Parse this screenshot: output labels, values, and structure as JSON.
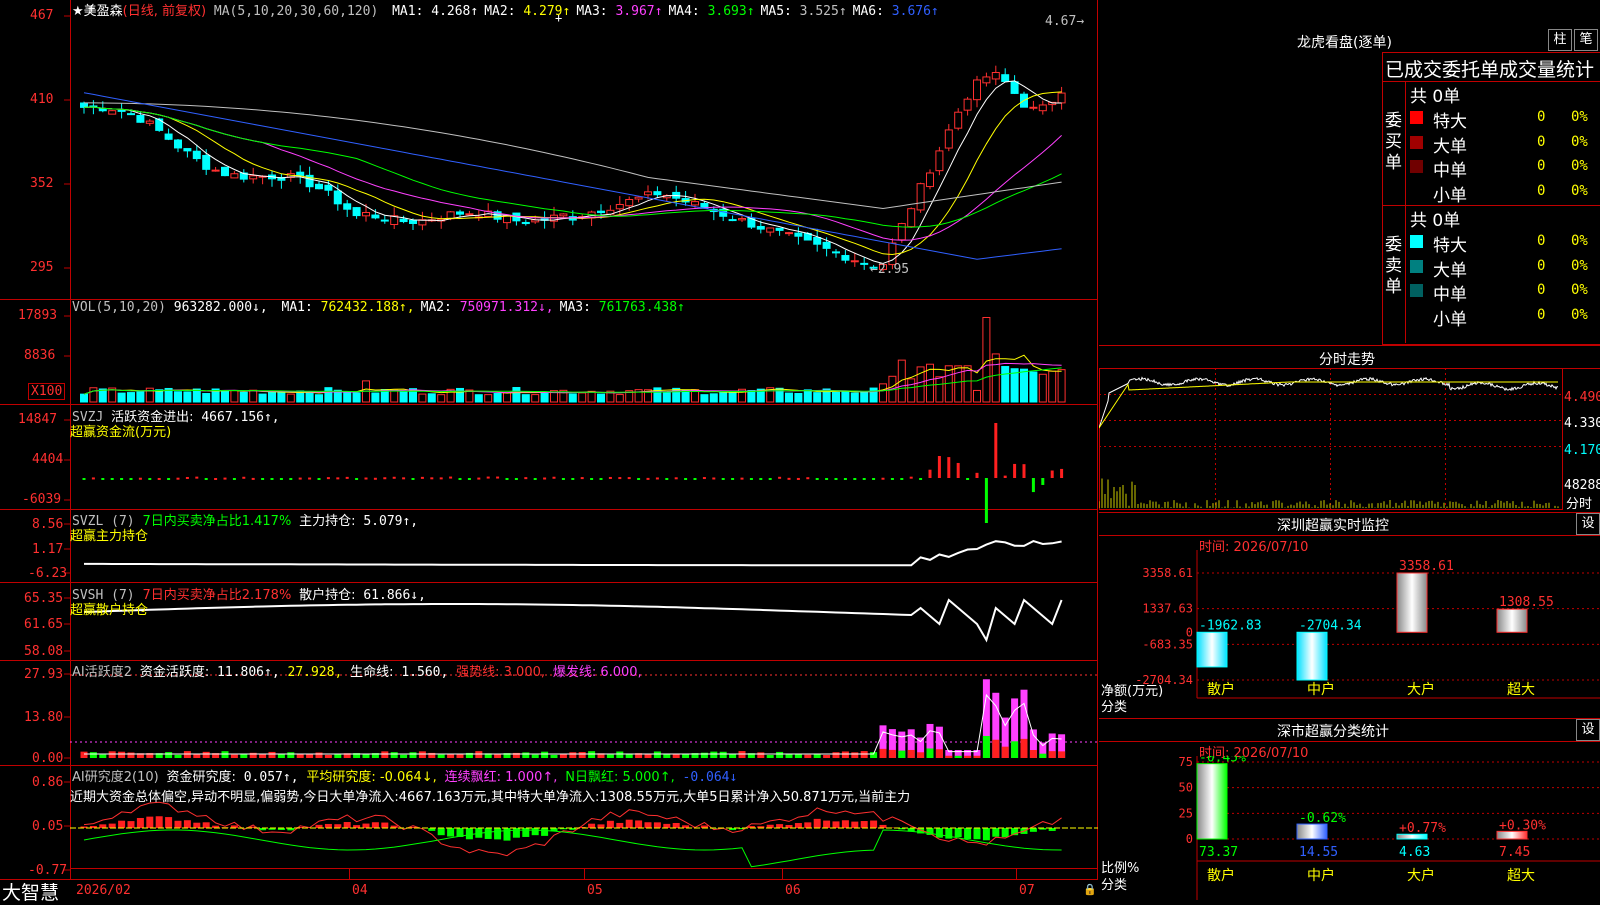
{
  "app": {
    "logo": "大智慧"
  },
  "main_chart": {
    "stock": "★美盈森",
    "period": "(日线, 前复权)",
    "ma_label": "MA(5,10,20,30,60,120)",
    "ma": [
      {
        "name": "MA1:",
        "value": "4.268↑",
        "color": "#ffffff"
      },
      {
        "name": "MA2:",
        "value": "4.279↑",
        "color": "#ffff00"
      },
      {
        "name": "MA3:",
        "value": "3.967↑",
        "color": "#ff40ff"
      },
      {
        "name": "MA4:",
        "value": "3.693↑",
        "color": "#00ff00"
      },
      {
        "name": "MA5:",
        "value": "3.525↑",
        "color": "#c0c0c0"
      },
      {
        "name": "MA6:",
        "value": "3.676↑",
        "color": "#3060ff"
      }
    ],
    "y_ticks": [
      "467",
      "410",
      "352",
      "295"
    ],
    "high_label": "4.67",
    "low_label": "2.95"
  },
  "volume": {
    "label": "VOL(5,10,20)",
    "vol_value": "963282.000↓,",
    "ma": [
      {
        "name": "MA1:",
        "value": "762432.188↑,",
        "color": "#ffff00"
      },
      {
        "name": "MA2:",
        "value": "750971.312↓,",
        "color": "#ff40ff"
      },
      {
        "name": "MA3:",
        "value": "761763.438↑",
        "color": "#00ff00"
      }
    ],
    "y_ticks": [
      "17893",
      "8836"
    ],
    "unit": "X100"
  },
  "svzj": {
    "label": "SVZJ",
    "desc": "活跃资金进出:",
    "value": "4667.156↑,",
    "subtitle": "超赢资金流(万元)",
    "y_ticks": [
      "14847",
      "4404",
      "-6039"
    ]
  },
  "svzl": {
    "label": "SVZL (7)",
    "desc1": "7日内买卖净占比1.417%",
    "desc2": "主力持仓:",
    "value": "5.079↑,",
    "subtitle": "超赢主力持仓",
    "y_ticks": [
      "8.56",
      "1.17",
      "-6.23"
    ]
  },
  "svsh": {
    "label": "SVSH (7)",
    "desc1": "7日内买卖净占比2.178%",
    "desc2": "散户持仓:",
    "value": "61.866↓,",
    "subtitle": "超赢散户持仓",
    "y_ticks": [
      "65.35",
      "61.65",
      "58.08"
    ]
  },
  "ai_active": {
    "label": "AI活跃度2",
    "desc": "资金活跃度:",
    "v1": "11.806↑,",
    "v2": "27.928,",
    "life_label": "生命线:",
    "life": "1.560,",
    "strong": "强势线: 3.000,",
    "burst": "爆发线: 6.000,",
    "y_ticks": [
      "27.93",
      "13.80",
      "0.00"
    ]
  },
  "ai_research": {
    "label": "AI研究度2(10)",
    "desc": "资金研究度:",
    "v1": "0.057↑,",
    "avg": "平均研究度: -0.064↓,",
    "cont": "连续飘红: 1.000↑,",
    "nday": "N日飘红: 5.000↑,",
    "v5": "-0.064↓",
    "summary": "近期大资金总体偏空,异动不明显,偏弱势,今日大单净流入:4667.163万元,其中特大单净流入:1308.55万元,大单5日累计净入50.871万元,当前主力",
    "y_ticks": [
      "0.86",
      "0.05",
      "-0.77"
    ]
  },
  "x_axis": [
    "2026/02",
    "04",
    "05",
    "06",
    "07"
  ],
  "right_panel": {
    "longhu": {
      "title": "龙虎看盘(逐单)",
      "btn1": "柱",
      "btn2": "笔",
      "header": "已成交委托单成交量统计",
      "buy_label": "委买单",
      "sell_label": "委卖单",
      "buy_total": "共 0单",
      "sell_total": "共 0单",
      "buy_rows": [
        {
          "name": "特大",
          "count": "0",
          "pct": "0%",
          "color": "#ff0000"
        },
        {
          "name": "大单",
          "count": "0",
          "pct": "0%",
          "color": "#a00000"
        },
        {
          "name": "中单",
          "count": "0",
          "pct": "0%",
          "color": "#700000"
        },
        {
          "name": "小单",
          "count": "0",
          "pct": "0%",
          "color": ""
        }
      ],
      "sell_rows": [
        {
          "name": "特大",
          "count": "0",
          "pct": "0%",
          "color": "#00ffff"
        },
        {
          "name": "大单",
          "count": "0",
          "pct": "0%",
          "color": "#008080"
        },
        {
          "name": "中单",
          "count": "0",
          "pct": "0%",
          "color": "#006060"
        },
        {
          "name": "小单",
          "count": "0",
          "pct": "0%",
          "color": ""
        }
      ]
    },
    "intraday": {
      "title": "分时走势",
      "y_ticks": [
        "4.490",
        "4.330",
        "4.170"
      ],
      "vol_tick": "48288",
      "bottom_label": "分时"
    },
    "sz_monitor": {
      "title": "深圳超赢实时监控",
      "btn": "设",
      "time": "时间: 2026/07/10",
      "y_ticks": [
        "3358.61",
        "1337.63",
        "-683.35",
        "-2704.34"
      ],
      "y_label": "净额(万元)",
      "x_label": "分类",
      "categories": [
        "散户",
        "中户",
        "大户",
        "超大"
      ],
      "values": [
        "-1962.83",
        "-2704.34",
        "3358.61",
        "1308.55"
      ]
    },
    "sz_stats": {
      "title": "深市超赢分类统计",
      "btn": "设",
      "time": "时间: 2026/07/10",
      "y_ticks": [
        "75",
        "50",
        "25",
        "0"
      ],
      "y_label": "比例%",
      "x_label": "分类",
      "categories": [
        "散户",
        "中户",
        "大户",
        "超大"
      ],
      "changes": [
        "-0.45%",
        "-0.62%",
        "+0.77%",
        "+0.30%"
      ],
      "values": [
        "73.37",
        "14.55",
        "4.63",
        "7.45"
      ]
    }
  }
}
